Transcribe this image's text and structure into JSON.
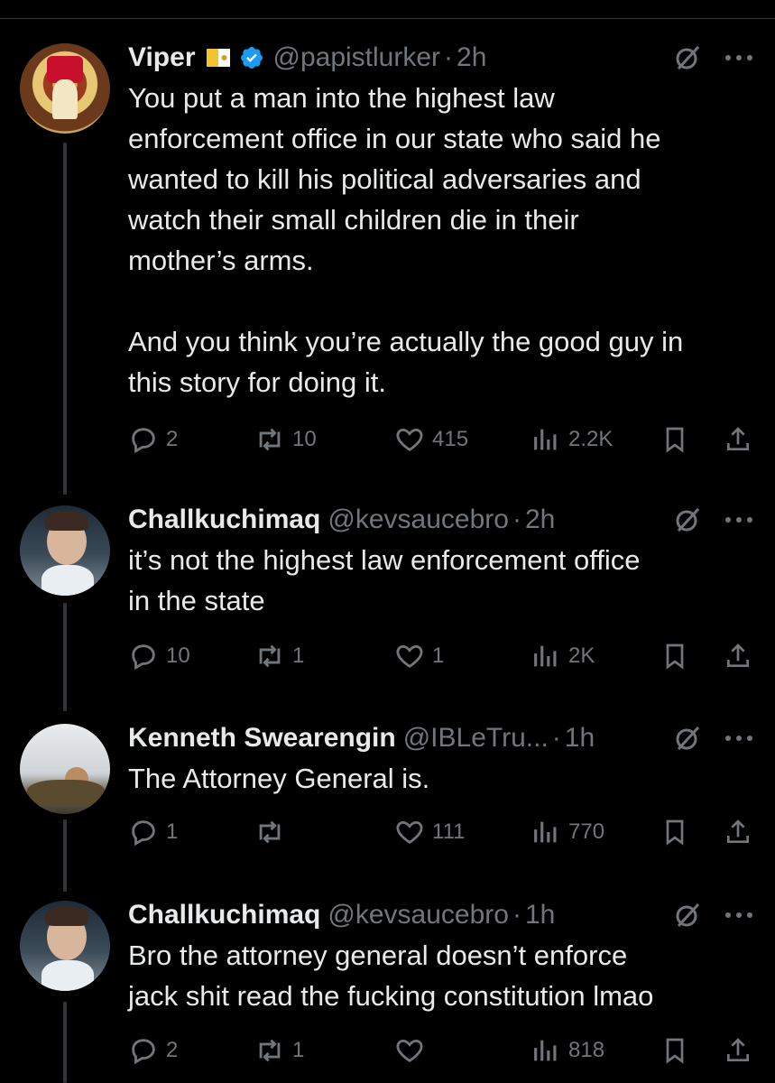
{
  "tweets": [
    {
      "name": "Viper",
      "handle": "@papistlurker",
      "dot": "·",
      "time": "2h",
      "text": "You put a man into the highest law\nenforcement office in our state who said he\nwanted to kill his political adversaries and\nwatch their small children die in their\nmother’s arms.\n\nAnd you think you’re actually the good guy in\nthis story for doing it.",
      "replies": "2",
      "reposts": "10",
      "likes": "415",
      "views": "2.2K"
    },
    {
      "name": "Challkuchimaq",
      "handle": "@kevsaucebro",
      "dot": "·",
      "time": "2h",
      "text": "it’s not the highest law enforcement office\nin the state",
      "replies": "10",
      "reposts": "1",
      "likes": "1",
      "views": "2K"
    },
    {
      "name": "Kenneth Swearengin",
      "handle": "@IBLeTru...",
      "dot": "·",
      "time": "1h",
      "text": "The Attorney General is.",
      "replies": "1",
      "reposts": "",
      "likes": "111",
      "views": "770"
    },
    {
      "name": "Challkuchimaq",
      "handle": "@kevsaucebro",
      "dot": "·",
      "time": "1h",
      "text": "Bro the attorney general doesn’t enforce\njack shit read the fucking constitution lmao",
      "replies": "2",
      "reposts": "1",
      "likes": "",
      "views": "818"
    }
  ],
  "icons": {
    "flag": "vatican-flag-icon",
    "verified": "verified-badge-icon",
    "grok": "grok-icon",
    "more": "more-icon",
    "reply": "reply-icon",
    "repost": "repost-icon",
    "like": "like-icon",
    "views": "views-icon",
    "bookmark": "bookmark-icon",
    "share": "share-icon"
  },
  "colors": {
    "background": "#000000",
    "text": "#e7e9ea",
    "secondary": "#71767b",
    "verified": "#1d9bf0",
    "thread_line": "#333639"
  }
}
